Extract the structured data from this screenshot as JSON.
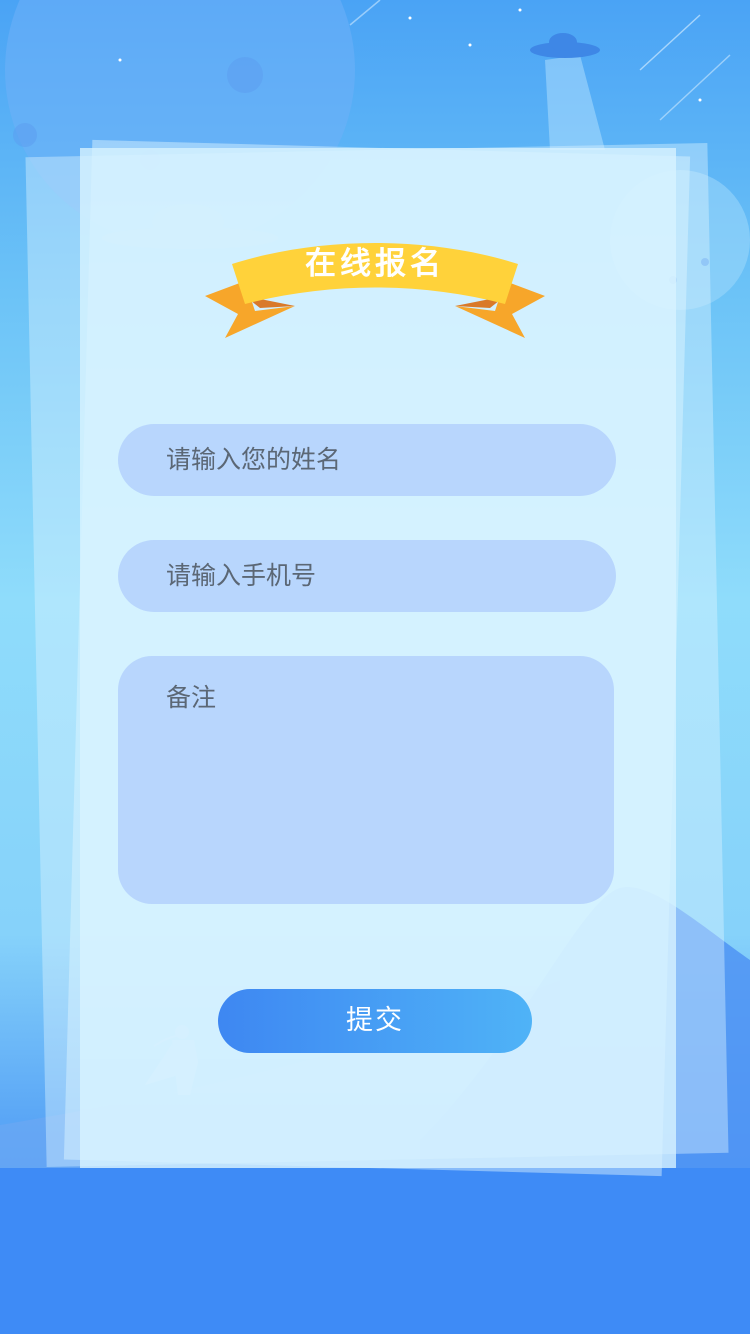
{
  "form": {
    "title": "在线报名",
    "name_placeholder": "请输入您的姓名",
    "phone_placeholder": "请输入手机号",
    "remark_placeholder": "备注",
    "submit_label": "提交"
  },
  "colors": {
    "field_bg": "#b8d6fd",
    "button_start": "#3e87f2",
    "button_end": "#4fb3f7",
    "ribbon": "#ffd23a",
    "ribbon_tail": "#f7a62a"
  }
}
